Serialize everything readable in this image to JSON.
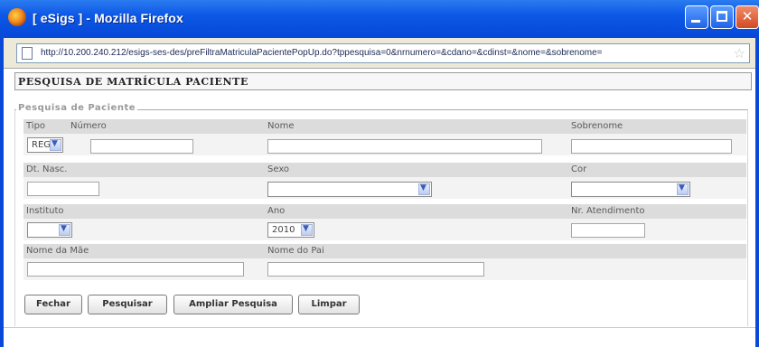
{
  "window": {
    "title": "[ eSigs ] - Mozilla Firefox",
    "url": "http://10.200.240.212/esigs-ses-des/preFiltraMatriculaPacientePopUp.do?tppesquisa=0&nrnumero=&cdano=&cdinst=&nome=&sobrenome="
  },
  "page": {
    "heading": "PESQUISA DE MATRÍCULA PACIENTE",
    "legend": "Pesquisa de Paciente"
  },
  "form": {
    "tipo_label": "Tipo",
    "tipo_value": "REG",
    "numero_label": "Número",
    "nome_label": "Nome",
    "sobrenome_label": "Sobrenome",
    "dtnasc_label": "Dt. Nasc.",
    "sexo_label": "Sexo",
    "sexo_value": "",
    "cor_label": "Cor",
    "cor_value": "",
    "instituto_label": "Instituto",
    "instituto_value": "",
    "ano_label": "Ano",
    "ano_value": "2010",
    "atendimento_label": "Nr. Atendimento",
    "mae_label": "Nome da Mãe",
    "pai_label": "Nome do Pai"
  },
  "buttons": {
    "fechar": "Fechar",
    "pesquisar": "Pesquisar",
    "ampliar": "Ampliar Pesquisa",
    "limpar": "Limpar"
  },
  "icons": {
    "app": "firefox-icon",
    "page": "page-icon",
    "bookmark": "star-icon",
    "dropdown": "chevron-down-icon"
  },
  "colors": {
    "titlebar": "#0c58e6",
    "close_button": "#d24a22",
    "label_row": "#dcdcdc"
  }
}
